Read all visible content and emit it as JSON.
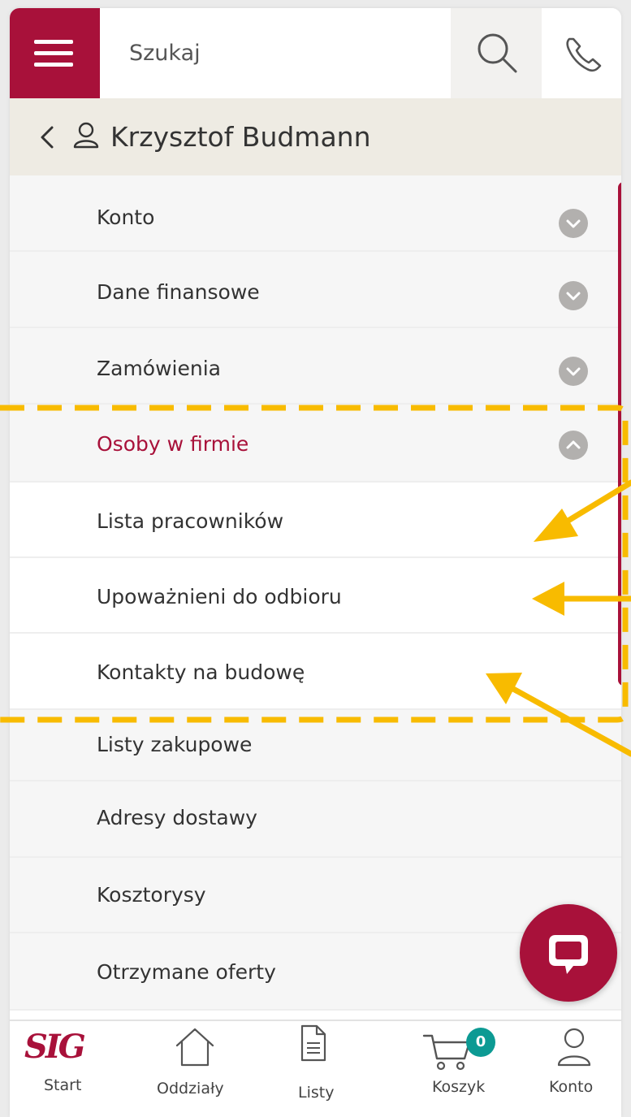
{
  "search": {
    "placeholder": "Szukaj"
  },
  "user": {
    "name": "Krzysztof Budmann"
  },
  "menu": {
    "konto": "Konto",
    "dane_finansowe": "Dane finansowe",
    "zamowienia": "Zamówienia",
    "osoby_w_firmie": "Osoby w firmie",
    "lista_pracownikow": "Lista pracowników",
    "upowaznieni": "Upoważnieni do odbioru",
    "kontakty": "Kontakty na budowę",
    "listy_zakupowe": "Listy zakupowe",
    "adresy_dostawy": "Adresy dostawy",
    "kosztorysy": "Kosztorysy",
    "otrzymane_oferty": "Otrzymane oferty"
  },
  "bottom_nav": {
    "logo_text": "SIG",
    "start": "Start",
    "oddzialy": "Oddziały",
    "listy": "Listy",
    "koszyk": "Koszyk",
    "konto": "Konto",
    "cart_count": "0"
  },
  "colors": {
    "brand": "#a8113a",
    "badge": "#0c9a93",
    "annotation": "#f8bb00"
  }
}
